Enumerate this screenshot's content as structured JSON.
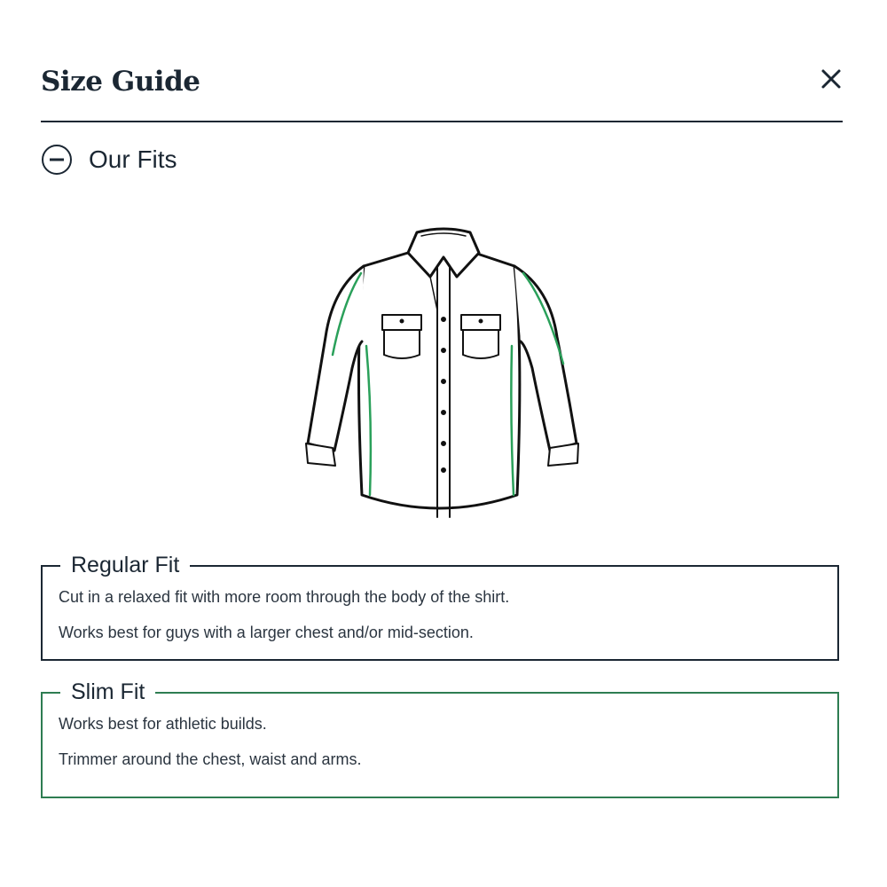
{
  "header": {
    "title": "Size Guide",
    "close_icon": "close-icon"
  },
  "section": {
    "label": "Our Fits",
    "toggle_icon": "collapse-minus-icon",
    "expanded": true
  },
  "illustration": {
    "icon": "shirt-fit-illustration",
    "outline_color": "#111111",
    "highlight_color": "#2aa05a"
  },
  "fits": [
    {
      "name": "Regular Fit",
      "lines": [
        "Cut in a relaxed fit with more room through the body of the shirt.",
        "Works best for guys with a larger chest and/or mid-section."
      ],
      "border_color": "#1b2733"
    },
    {
      "name": "Slim Fit",
      "lines": [
        "Works best for athletic builds.",
        "Trimmer around the chest, waist and arms."
      ],
      "border_color": "#2e7d52"
    }
  ],
  "colors": {
    "text": "#1b2733",
    "accent_green": "#2e7d52"
  }
}
